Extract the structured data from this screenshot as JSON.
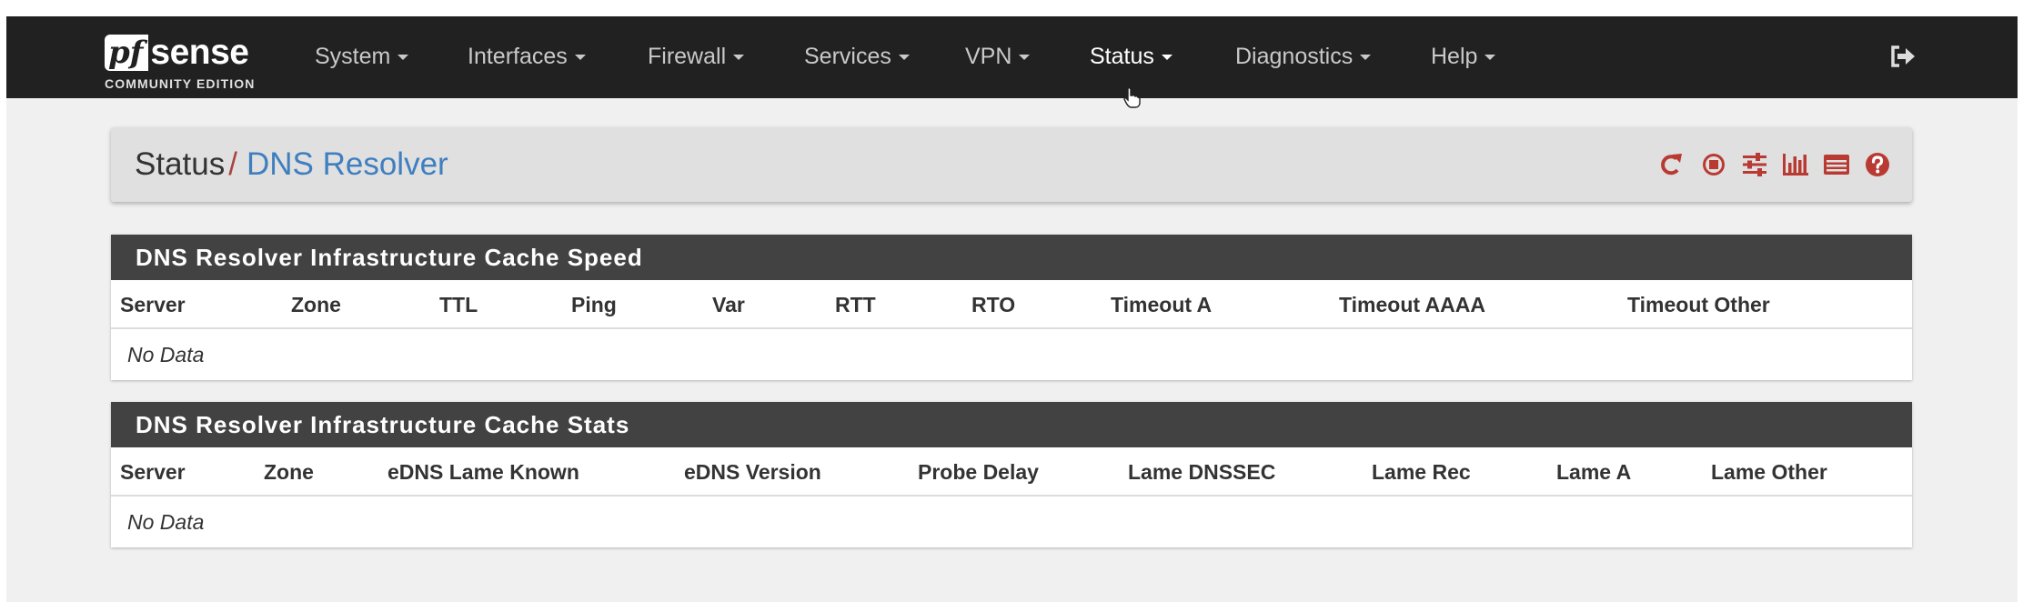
{
  "navbar": {
    "brand": {
      "logo_pf": "pf",
      "logo_sense": "sense",
      "edition": "COMMUNITY EDITION"
    },
    "menu": [
      {
        "label": "System"
      },
      {
        "label": "Interfaces"
      },
      {
        "label": "Firewall"
      },
      {
        "label": "Services"
      },
      {
        "label": "VPN"
      },
      {
        "label": "Status"
      },
      {
        "label": "Diagnostics"
      },
      {
        "label": "Help"
      }
    ],
    "active_menu": "Status",
    "logout_icon": "sign-out-icon"
  },
  "breadcrumb": {
    "section": "Status",
    "separator": "/",
    "page": "DNS Resolver",
    "icons": [
      "restart-service-icon",
      "stop-service-icon",
      "settings-sliders-icon",
      "bar-chart-icon",
      "log-list-icon",
      "help-icon"
    ]
  },
  "speed_table": {
    "title": "DNS Resolver Infrastructure Cache Speed",
    "columns": [
      "Server",
      "Zone",
      "TTL",
      "Ping",
      "Var",
      "RTT",
      "RTO",
      "Timeout A",
      "Timeout AAAA",
      "Timeout Other"
    ],
    "empty_text": "No Data"
  },
  "stats_table": {
    "title": "DNS Resolver Infrastructure Cache Stats",
    "columns": [
      "Server",
      "Zone",
      "eDNS Lame Known",
      "eDNS Version",
      "Probe Delay",
      "Lame DNSSEC",
      "Lame Rec",
      "Lame A",
      "Lame Other"
    ],
    "empty_text": "No Data"
  },
  "colors": {
    "navbar_bg": "#212121",
    "panel_heading_bg": "#424242",
    "accent_red": "#b93a32",
    "link_blue": "#3f7fbf"
  }
}
